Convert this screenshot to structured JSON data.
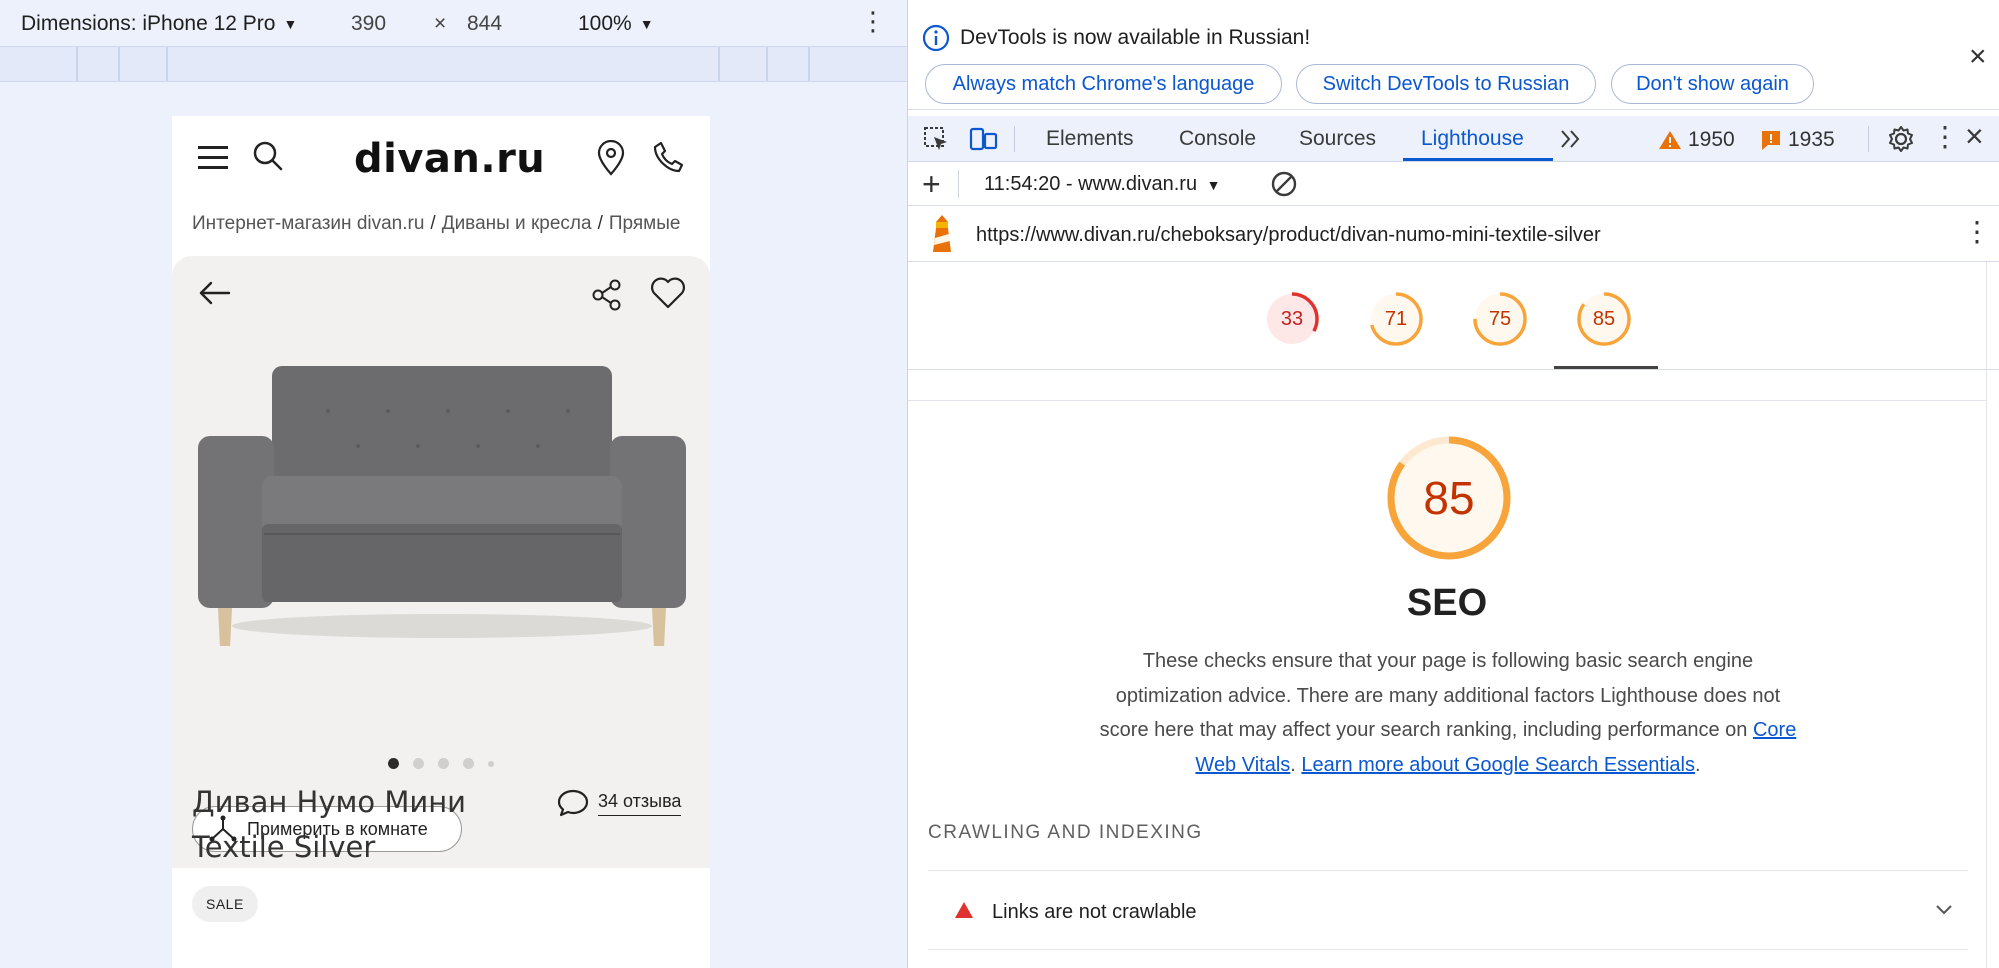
{
  "device_toolbar": {
    "dimensions_label": "Dimensions: iPhone 12 Pro",
    "width": "390",
    "times": "×",
    "height": "844",
    "zoom": "100%"
  },
  "site": {
    "logo": "divan.ru",
    "breadcrumbs": [
      "Интернет-магазин divan.ru",
      "Диваны и кресла",
      "Прямые"
    ],
    "try_in_room": "Примерить в комнате",
    "product_title": "Диван Нумо Мини Textile Silver",
    "reviews": "34 отзыва",
    "badge": "SALE",
    "gallery_dots": 5
  },
  "devtools": {
    "info_message": "DevTools is now available in Russian!",
    "info_buttons": [
      "Always match Chrome's language",
      "Switch DevTools to Russian",
      "Don't show again"
    ],
    "tabs": [
      "Elements",
      "Console",
      "Sources",
      "Lighthouse"
    ],
    "active_tab": "Lighthouse",
    "warnings_count": "1950",
    "issues_count": "1935",
    "report_label": "11:54:20 - www.divan.ru",
    "url": "https://www.divan.ru/cheboksary/product/divan-numo-mini-textile-silver",
    "scores": [
      {
        "value": "33",
        "color": "#e0332f",
        "fill": 0.33
      },
      {
        "value": "71",
        "color": "#f7a43a",
        "fill": 0.71
      },
      {
        "value": "75",
        "color": "#f7a43a",
        "fill": 0.75
      },
      {
        "value": "85",
        "color": "#f7a43a",
        "fill": 0.85
      }
    ],
    "selected_score": "85",
    "category": {
      "score": "85",
      "title": "SEO",
      "desc_before": "These checks ensure that your page is following basic search engine optimization advice. There are many additional factors Lighthouse does not score here that may affect your search ranking, including performance on ",
      "link1": "Core Web Vitals",
      "mid": ". ",
      "link2": "Learn more about Google Search Essentials",
      "end": "."
    },
    "section_heading": "CRAWLING AND INDEXING",
    "audit": "Links are not crawlable"
  },
  "colors": {
    "accent": "#0b57d0",
    "score_orange": "#f7a43a",
    "score_red": "#e0332f",
    "score_text_orange": "#c33300"
  }
}
